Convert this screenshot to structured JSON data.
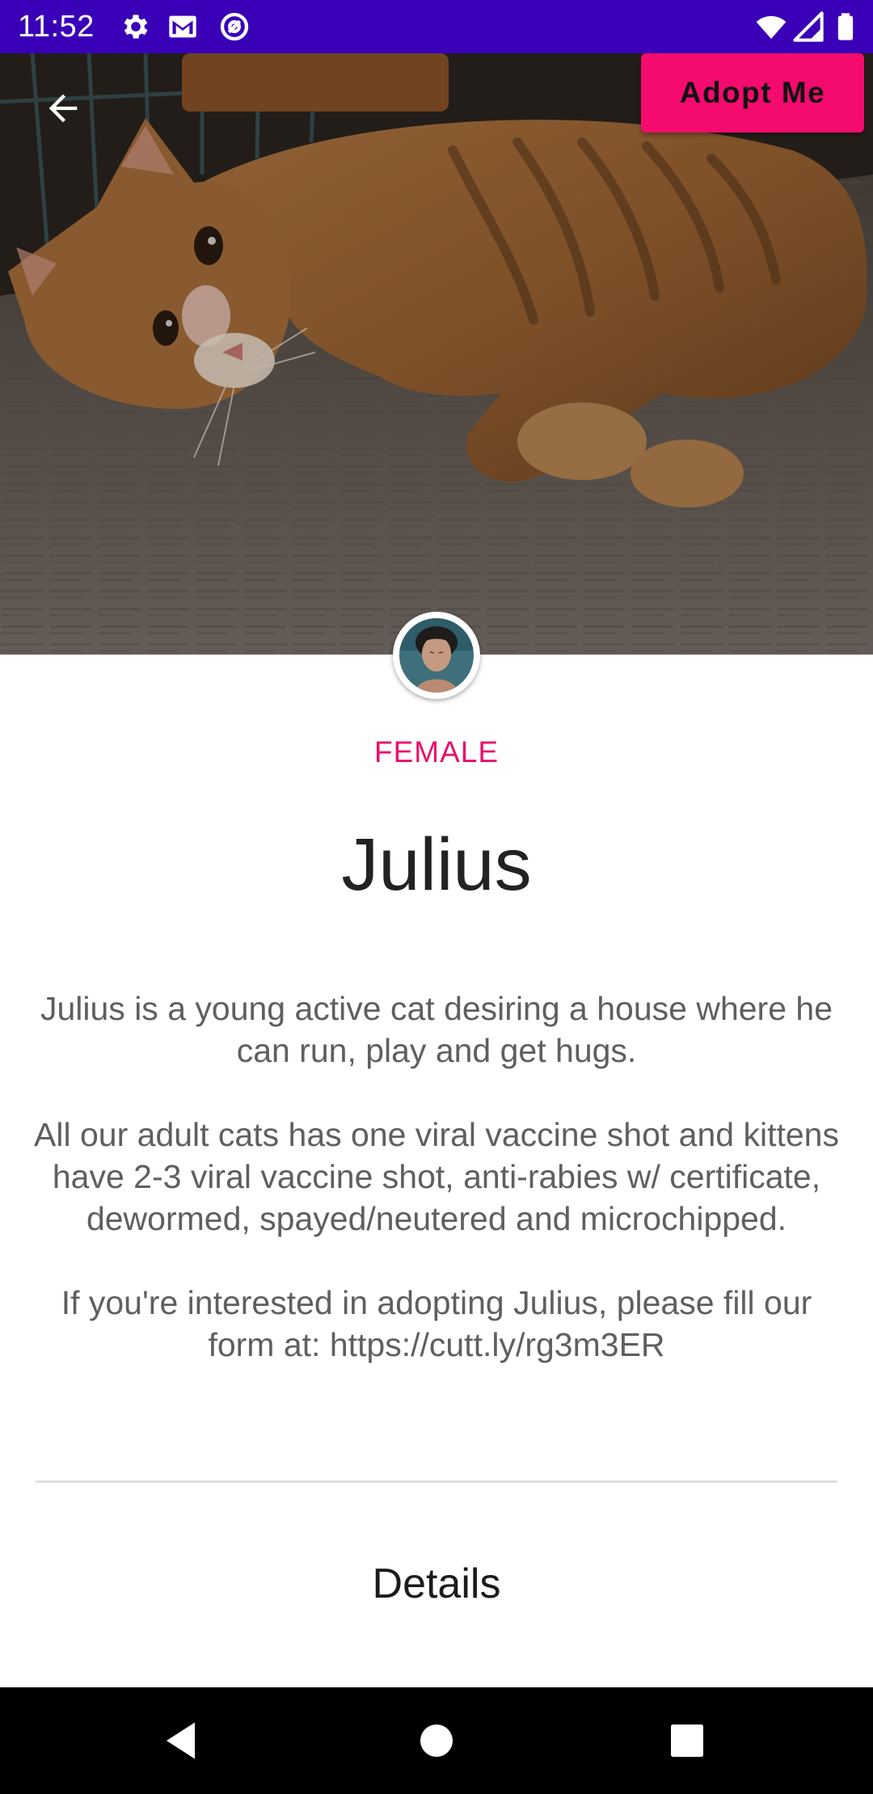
{
  "status_bar": {
    "time": "11:52",
    "icons_left": [
      "settings-icon",
      "gmail-icon",
      "at-sign-icon"
    ],
    "icons_right": [
      "wifi-icon",
      "signal-icon",
      "battery-icon"
    ],
    "background": "#3a00b8"
  },
  "header": {
    "back_icon": "arrow-left-icon",
    "adopt_label": "Adopt Me",
    "adopt_color": "#f50a6e"
  },
  "pet": {
    "gender": "FEMALE",
    "name": "Julius",
    "description": [
      "Julius is a young active cat desiring a house where he can run, play and get hugs.",
      "All our adult cats has one viral vaccine shot and kittens have 2-3 viral vaccine shot, anti-rabies w/ certificate, dewormed, spayed/neutered and microchipped.",
      "If you're interested in adopting Julius, please fill our form at: https://cutt.ly/rg3m3ER"
    ],
    "accent_color": "#e8106c"
  },
  "sections": {
    "details_heading": "Details"
  },
  "nav_bar": {
    "buttons": [
      "back-triangle-icon",
      "home-circle-icon",
      "recents-square-icon"
    ]
  }
}
